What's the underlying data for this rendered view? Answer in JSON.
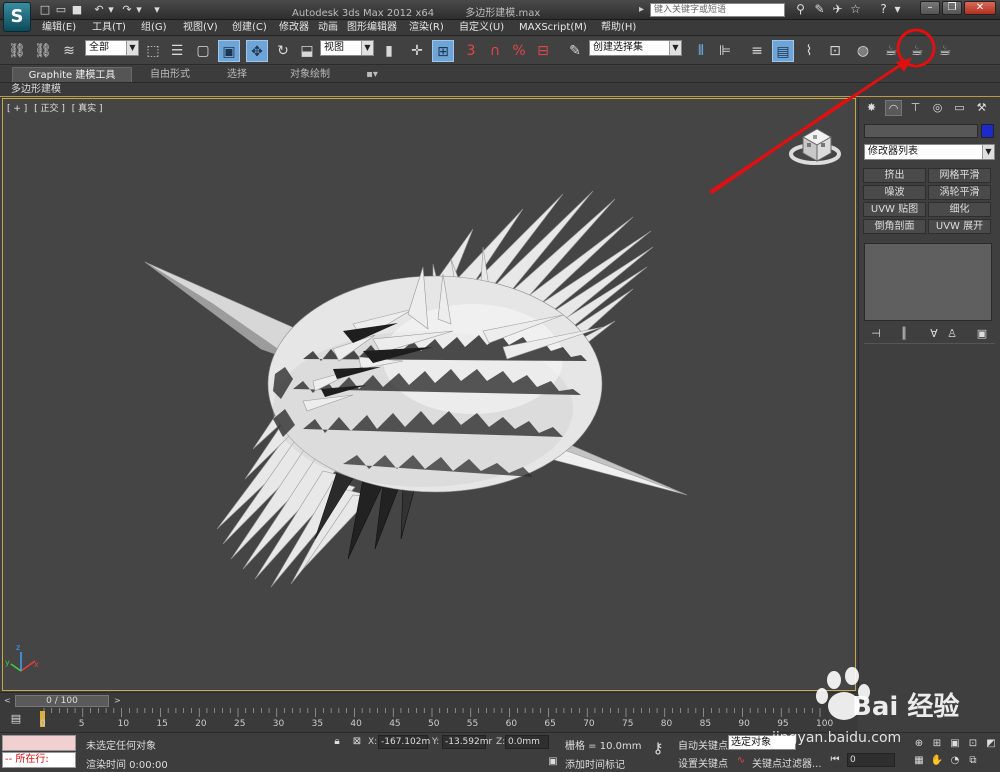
{
  "window": {
    "title_parts": [
      "Autodesk 3ds Max  2012 x64",
      "多边形建模.max"
    ],
    "search_placeholder": "键入关键字或短语",
    "logo_letter": "S"
  },
  "menu": [
    "编辑(E)",
    "工具(T)",
    "组(G)",
    "视图(V)",
    "创建(C)",
    "修改器",
    "动画",
    "图形编辑器",
    "渲染(R)",
    "自定义(U)",
    "MAXScript(M)",
    "帮助(H)"
  ],
  "toolbar": {
    "selection_filter": "全部",
    "ref_coord": "视图",
    "named_selection": "创建选择集",
    "snap_label": "3"
  },
  "ribbon": {
    "tabs": [
      "Graphite 建模工具",
      "自由形式",
      "选择",
      "对象绘制"
    ],
    "active_tab": "Graphite 建模工具",
    "sub_label": "多边形建模"
  },
  "viewport": {
    "labels": [
      "[ + ]",
      "[ 正交 ]",
      "[ 真实 ]"
    ],
    "axis_x": "x",
    "axis_y": "y",
    "axis_z": "z"
  },
  "command_panel": {
    "modifier_list": "修改器列表",
    "modifier_buttons": [
      "挤出",
      "网格平滑",
      "噪波",
      "涡轮平滑",
      "UVW 贴图",
      "细化",
      "倒角剖面",
      "UVW 展开"
    ],
    "object_color": "#1c2acb"
  },
  "timeline": {
    "slider_label": "0 / 100",
    "ticks": [
      "0",
      "5",
      "10",
      "15",
      "20",
      "25",
      "30",
      "35",
      "40",
      "45",
      "50",
      "55",
      "60",
      "65",
      "70",
      "75",
      "80",
      "85",
      "90",
      "95",
      "100"
    ]
  },
  "status": {
    "maxscript_label": "所在行:",
    "selection_status": "未选定任何对象",
    "render_time": "渲染时间  0:00:00",
    "x_label": "X:",
    "x_value": "-167.102m",
    "y_label": "Y:",
    "y_value": "-13.592mr",
    "z_label": "Z:",
    "z_value": "0.0mm",
    "grid": "栅格 = 10.0mm",
    "add_time_tag": "添加时间标记",
    "auto_key": "自动关键点",
    "set_key": "设置关键点",
    "selection_set": "选定对象",
    "key_filters": "关键点过滤器...",
    "frame": "0"
  },
  "watermark": {
    "brand": "Bai 经验",
    "url": "jingyan.baidu.com"
  },
  "colors": {
    "viewport_bg": "#454545",
    "viewport_border": "#c9a64a",
    "annotation_red": "#e01010",
    "active_tool": "#6fa4d6"
  }
}
